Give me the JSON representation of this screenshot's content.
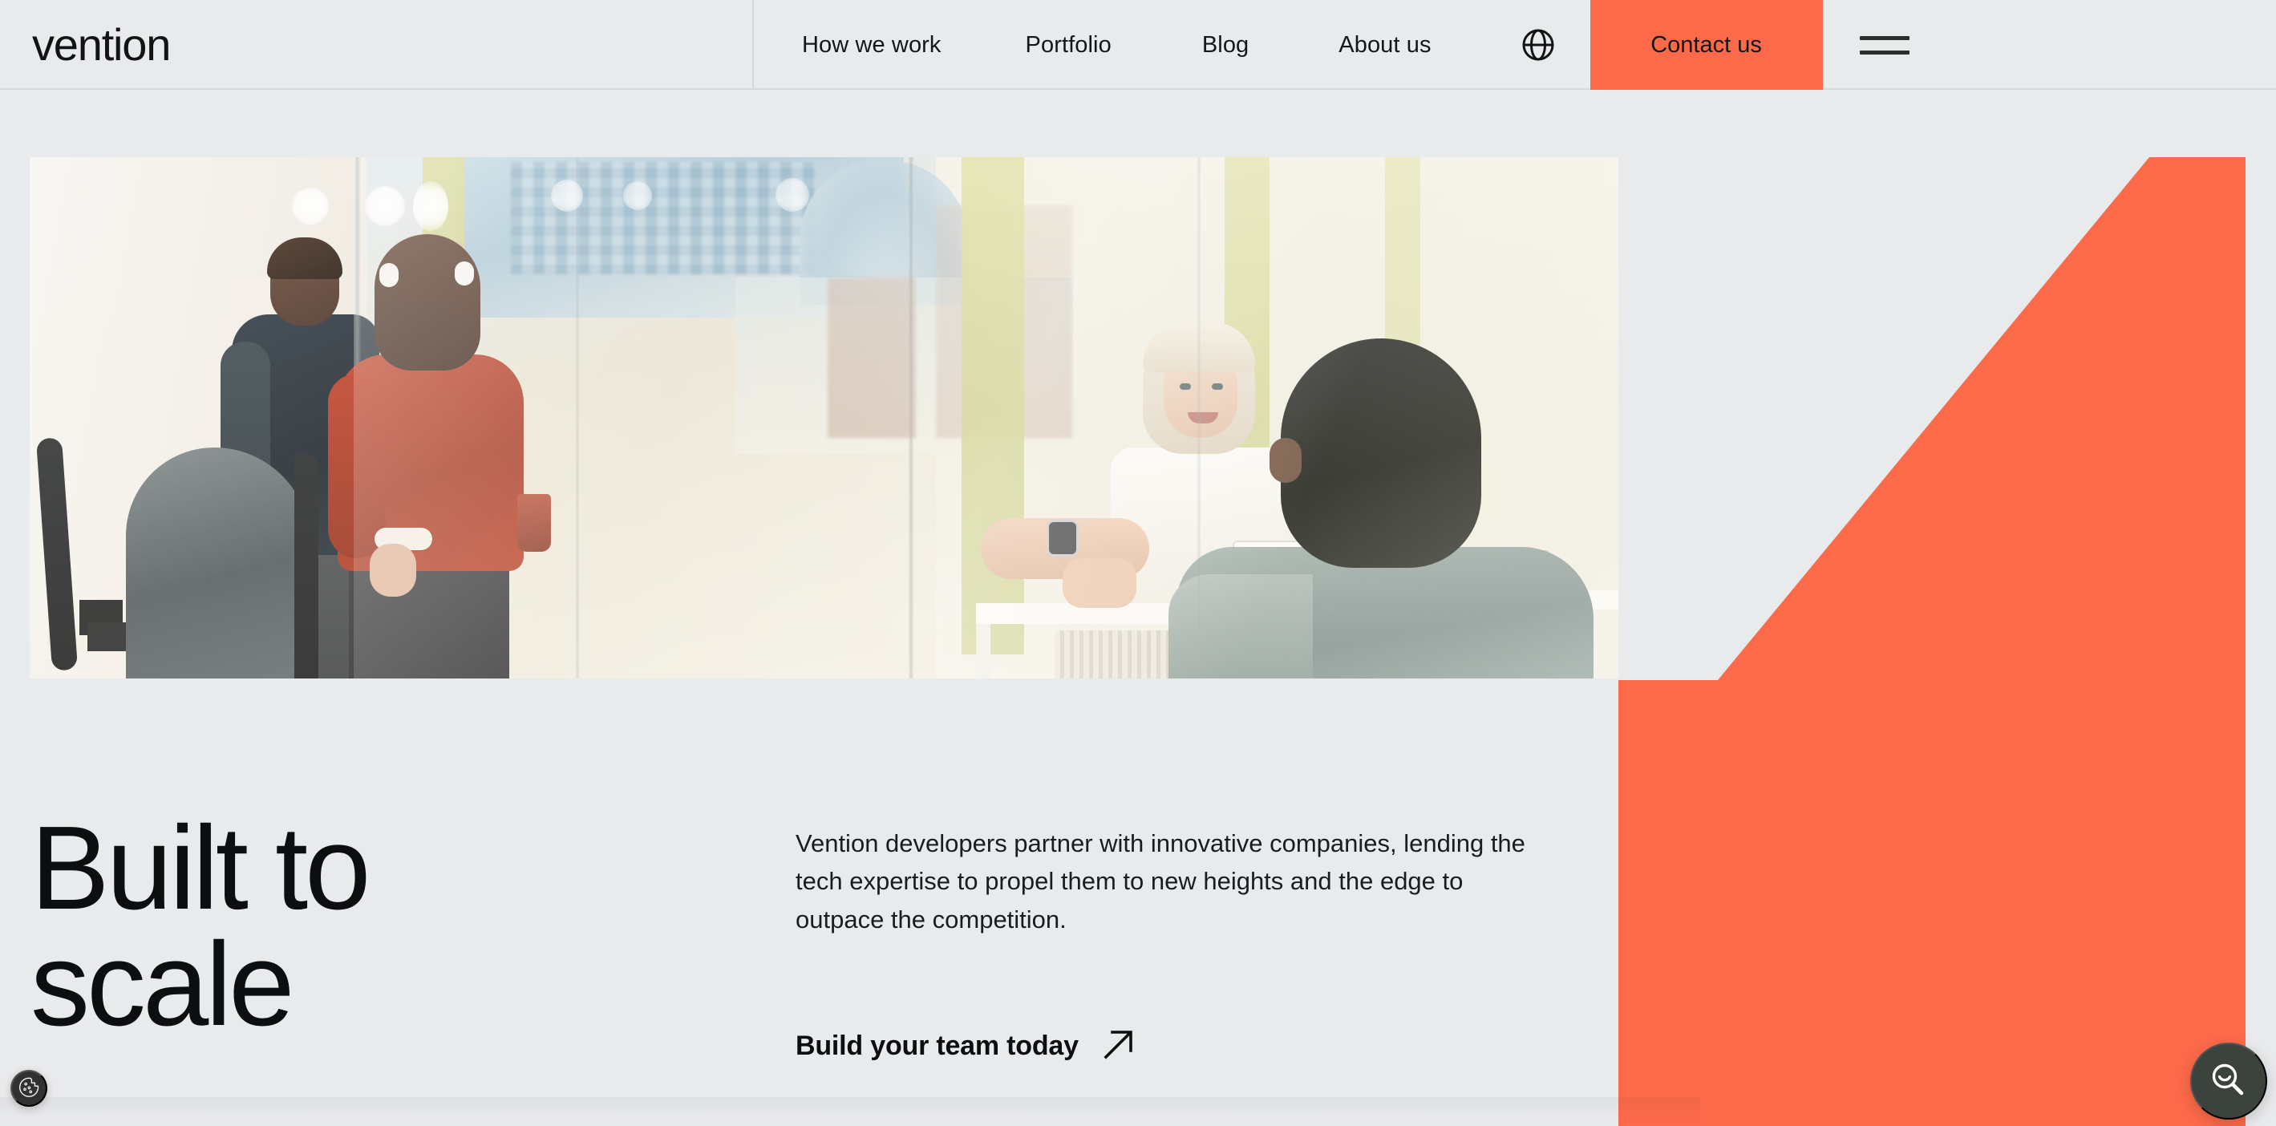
{
  "brand": {
    "logo_text": "vention",
    "accent_color": "#FC6A4A",
    "background_color": "#E9EAEC",
    "text_color": "#0C0E0F",
    "dark_button_color": "#3C423C"
  },
  "header": {
    "nav_items": [
      {
        "label": "How we work"
      },
      {
        "label": "Portfolio"
      },
      {
        "label": "Blog"
      },
      {
        "label": "About us"
      }
    ],
    "language_icon": "globe-icon",
    "contact_button": "Contact us",
    "menu_icon": "hamburger-menu-icon"
  },
  "hero": {
    "image_alt": "Office meeting through glass partition: colleagues talking across a white table",
    "title": "Built to\nscale",
    "paragraph": "Vention developers partner with innovative companies, lending the tech expertise to propel them to new heights and the edge to outpace the competition.",
    "cta_label": "Build your team today",
    "cta_icon": "arrow-up-right-icon",
    "decoration": "orange-diagonal-arrow-shape"
  },
  "floating": {
    "cookie_icon": "cookie-icon",
    "search_icon": "search-icon"
  }
}
